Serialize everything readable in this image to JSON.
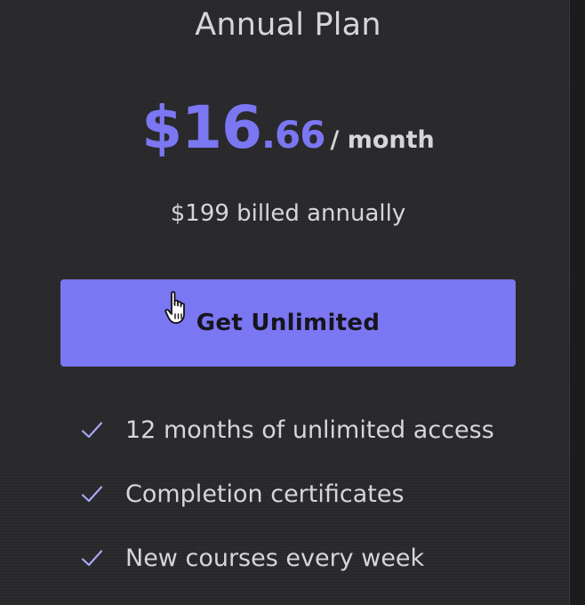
{
  "plan": {
    "title": "Annual Plan",
    "price_whole": "$16",
    "price_cents": ".66",
    "price_unit": "/ month",
    "billing_note": "$199 billed annually",
    "cta_label": "Get Unlimited"
  },
  "features": [
    {
      "text": "12 months of unlimited access",
      "icon": "check-icon"
    },
    {
      "text": "Completion certificates",
      "icon": "check-icon"
    },
    {
      "text": "New courses every week",
      "icon": "check-icon"
    }
  ],
  "colors": {
    "accent": "#7b76f1",
    "background": "#272729",
    "text": "#d6d6d8",
    "button_text": "#16151f"
  },
  "cursor": {
    "icon": "hand-pointer-icon"
  }
}
